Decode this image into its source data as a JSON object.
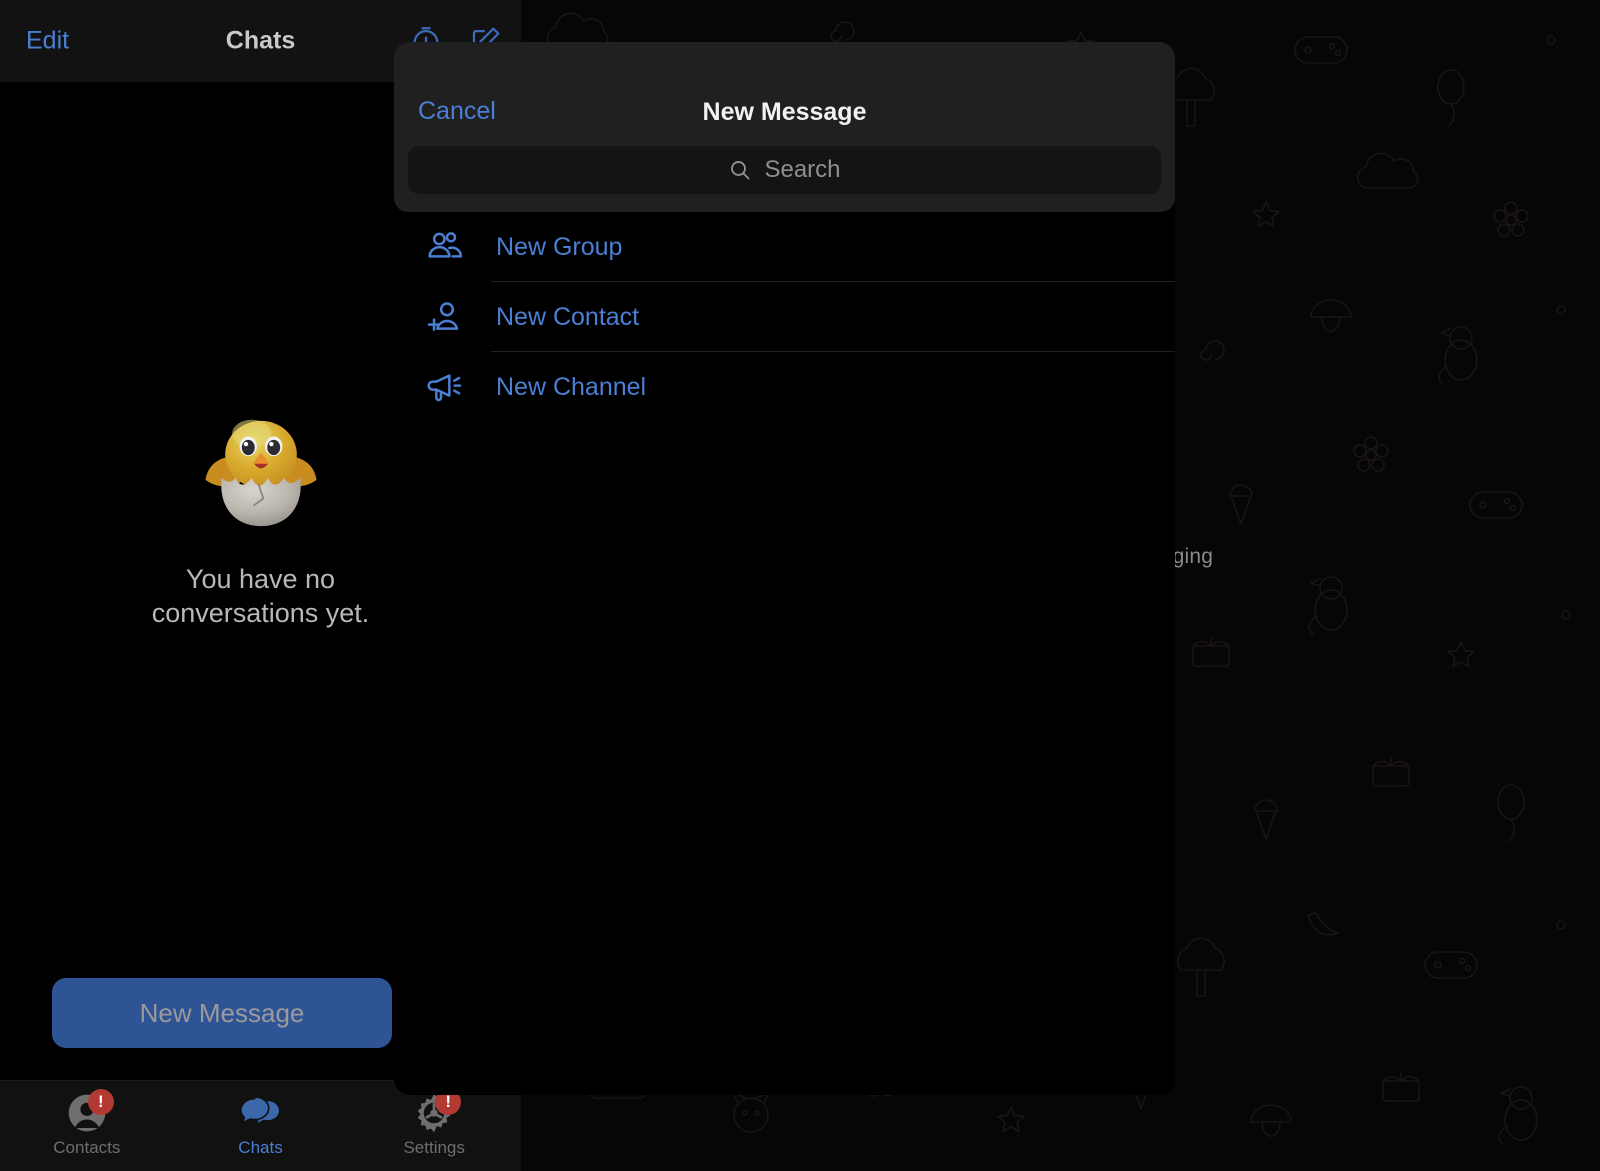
{
  "colors": {
    "accent_blue": "#4a7fd4",
    "cta_blue": "#2f5496",
    "badge_red": "#b23a32",
    "header_gray": "#202021",
    "panel_black": "#000000",
    "topbar_black": "#121212",
    "tabbar_black": "#111111",
    "muted_text": "#8e8e93"
  },
  "sidebar": {
    "topbar": {
      "edit_label": "Edit",
      "title": "Chats",
      "actions": [
        {
          "name": "timer-icon",
          "glyph": "timer"
        },
        {
          "name": "compose-icon",
          "glyph": "compose"
        }
      ]
    },
    "empty_state": {
      "emoji_name": "hatching-chick-emoji",
      "text": "You have no conversations yet."
    },
    "cta_label": "New Message",
    "tabs": [
      {
        "label": "Contacts",
        "icon": "contacts-icon",
        "active": false,
        "badge": "!"
      },
      {
        "label": "Chats",
        "icon": "chats-icon",
        "active": true,
        "badge": ""
      },
      {
        "label": "Settings",
        "icon": "settings-gear-icon",
        "active": false,
        "badge": "!"
      }
    ]
  },
  "chat_pane": {
    "placeholder_text": "Select a chat to start messaging"
  },
  "modal": {
    "cancel_label": "Cancel",
    "title": "New Message",
    "search": {
      "placeholder": "Search",
      "value": "",
      "icon": "search-icon"
    },
    "menu_items": [
      {
        "label": "New Group",
        "icon": "group-icon"
      },
      {
        "label": "New Contact",
        "icon": "person-add-icon"
      },
      {
        "label": "New Channel",
        "icon": "megaphone-icon"
      }
    ]
  }
}
